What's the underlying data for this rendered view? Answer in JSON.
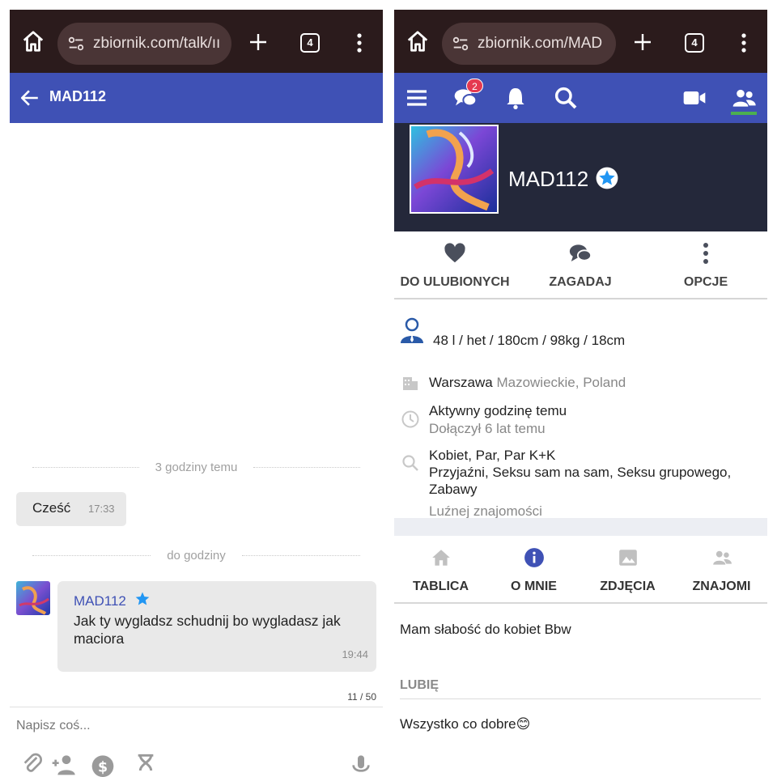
{
  "left_screen": {
    "browser": {
      "url": "zbiornik.com/talk/ıı",
      "tab_count": "4"
    },
    "header": {
      "title": "MAD112"
    },
    "dividers": [
      "3 godziny temu",
      "do godziny"
    ],
    "messages": [
      {
        "text": "Cześć",
        "time": "17:33"
      },
      {
        "sender": "MAD112",
        "text": "Jak ty wygladsz schudnij bo wygladasz jak maciora",
        "time": "19:44"
      }
    ],
    "char_counter": "11 / 50",
    "input": {
      "placeholder": "Napisz coś..."
    },
    "toolbar_icons": [
      "attach-icon",
      "add-user-icon",
      "money-icon",
      "hourglass-icon",
      "mic-icon"
    ]
  },
  "right_screen": {
    "browser": {
      "url": "zbiornik.com/MAD",
      "tab_count": "4"
    },
    "nav": {
      "messages_badge": "2",
      "icons": [
        "menu-icon",
        "chat-icon",
        "bell-icon",
        "search-icon",
        "video-icon",
        "friends-icon"
      ]
    },
    "profile": {
      "name": "MAD112"
    },
    "actions": [
      "DO ULUBIONYCH",
      "ZAGADAJ",
      "OPCJE"
    ],
    "info": {
      "stats": "48 l / het / 180cm / 98kg / 18cm",
      "city": "Warszawa",
      "region": "Mazowieckie, Poland",
      "active": "Aktywny godzinę temu",
      "joined": "Dołączył 6 lat temu",
      "seeking_who": "Kobiet, Par, Par K+K",
      "seeking_what": "Przyjaźni, Seksu sam na sam, Seksu grupowego, Zabawy",
      "seeking_extra": "Luźnej znajomości"
    },
    "tabs": [
      "TABLICA",
      "O MNIE",
      "ZDJĘCIA",
      "ZNAJOMI"
    ],
    "about": "Mam słabość do kobiet Bbw",
    "likes_heading": "LUBIĘ",
    "likes": "Wszystko co dobre😊"
  },
  "colors": {
    "accent": "#3f51b5",
    "browser_bar": "#2b1b1c",
    "hero": "#24283a",
    "badge": "#e53950",
    "active_tab": "#4caf50",
    "verified": "#2196f3"
  }
}
